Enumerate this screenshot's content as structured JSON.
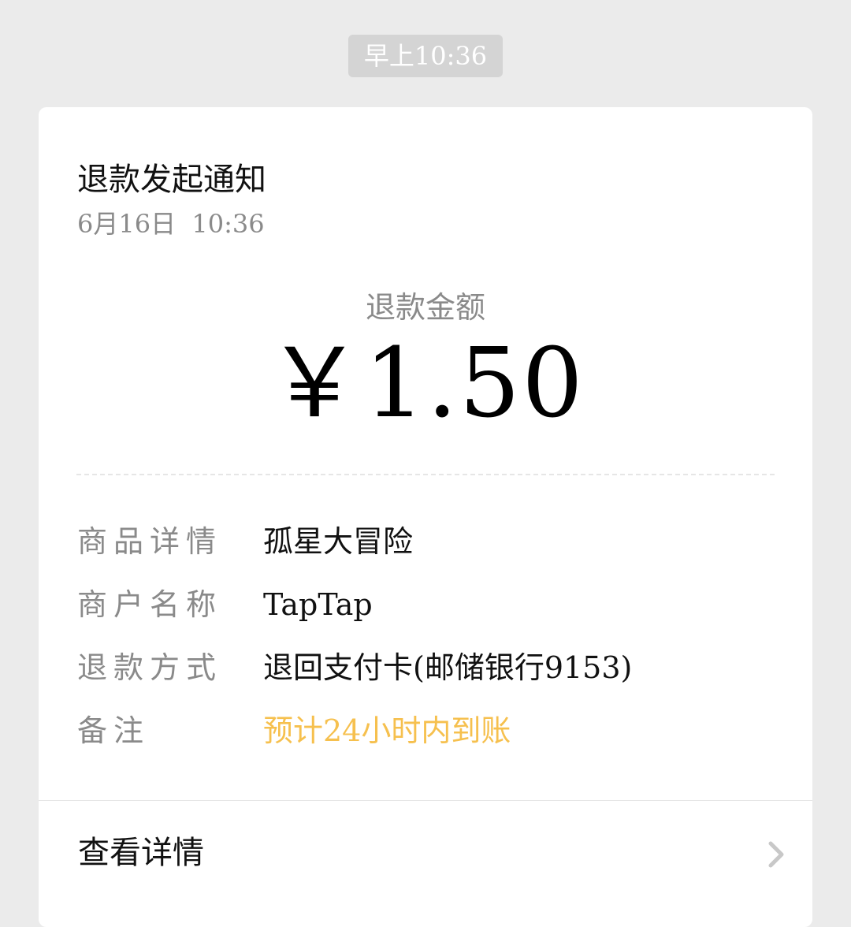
{
  "chat": {
    "timestamp": "早上10:36"
  },
  "card": {
    "title": "退款发起通知",
    "date": "6月16日  10:36",
    "amount_label": "退款金额",
    "amount_value": "￥1.50",
    "rows": [
      {
        "label": "商品详情",
        "value": "孤星大冒险"
      },
      {
        "label": "商户名称",
        "value": "TapTap"
      },
      {
        "label": "退款方式",
        "value": "退回支付卡(邮储银行9153)"
      },
      {
        "label": "备注",
        "value": "预计24小时内到账"
      }
    ],
    "details_label": "查看详情"
  },
  "colors": {
    "background": "#ebebeb",
    "card": "#ffffff",
    "muted_text": "#8a8a8a",
    "highlight": "#f6c04e",
    "chevron": "#c8c8c8"
  },
  "icons": {
    "details_chevron": "chevron-right-icon"
  }
}
